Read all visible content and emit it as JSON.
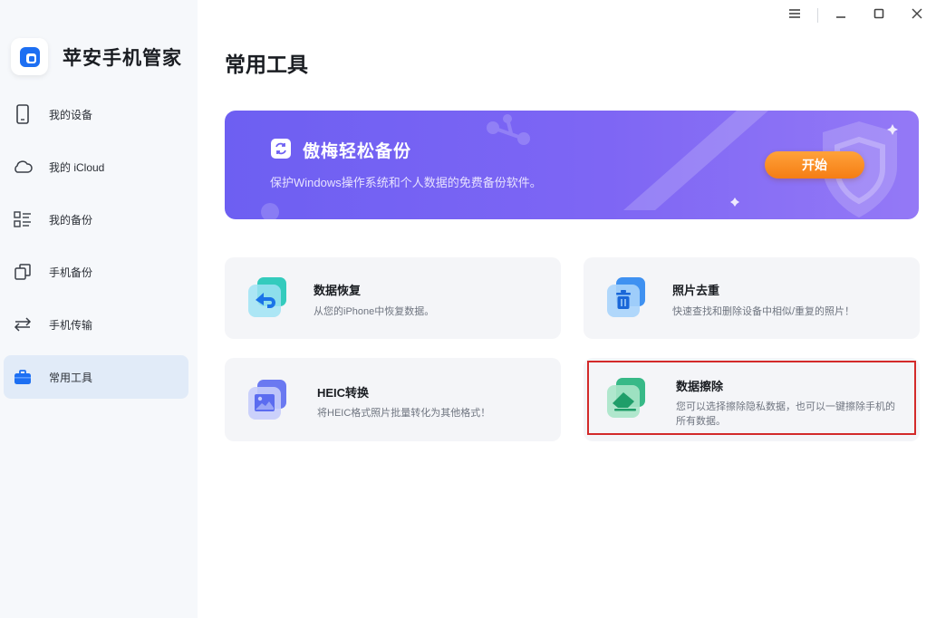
{
  "app": {
    "name": "苹安手机管家"
  },
  "sidebar": {
    "items": [
      {
        "label": "我的设备",
        "icon": "phone-icon"
      },
      {
        "label": "我的 iCloud",
        "icon": "cloud-icon"
      },
      {
        "label": "我的备份",
        "icon": "backup-list-icon"
      },
      {
        "label": "手机备份",
        "icon": "copy-icon"
      },
      {
        "label": "手机传输",
        "icon": "transfer-icon"
      },
      {
        "label": "常用工具",
        "icon": "toolbox-icon",
        "active": true
      }
    ]
  },
  "window": {
    "controls": [
      "menu-icon",
      "minimize-icon",
      "maximize-icon",
      "close-icon"
    ]
  },
  "main": {
    "title": "常用工具",
    "banner": {
      "title": "傲梅轻松备份",
      "subtitle": "保护Windows操作系统和个人数据的免费备份软件。",
      "button": "开始"
    },
    "tools": [
      {
        "title": "数据恢复",
        "desc": "从您的iPhone中恢复数据。"
      },
      {
        "title": "照片去重",
        "desc": "快速查找和删除设备中相似/重复的照片！"
      },
      {
        "title": "HEIC转换",
        "desc": "将HEIC格式照片批量转化为其他格式！"
      },
      {
        "title": "数据擦除",
        "desc": "您可以选择擦除隐私数据，也可以一键擦除手机的所有数据。"
      }
    ]
  },
  "colors": {
    "accent": "#1d6ff2",
    "banner_start": "#6d5ff2",
    "banner_end": "#9479f6",
    "start_button": "#f58a1f",
    "highlight": "#d32a2a"
  }
}
